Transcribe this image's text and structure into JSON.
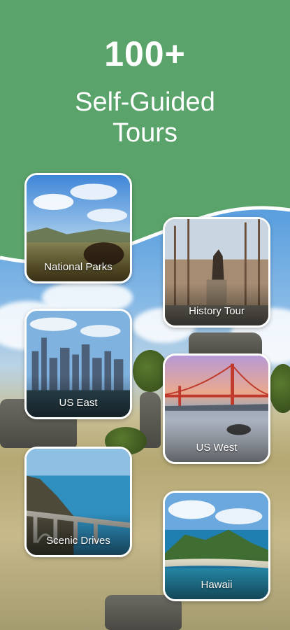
{
  "header": {
    "count": "100+",
    "line1": "Self-Guided",
    "line2": "Tours",
    "color": "#5aa36a"
  },
  "cards": [
    {
      "label": "National Parks",
      "icon": "national-parks-photo"
    },
    {
      "label": "History Tour",
      "icon": "history-tour-photo"
    },
    {
      "label": "US East",
      "icon": "us-east-photo"
    },
    {
      "label": "US West",
      "icon": "us-west-photo"
    },
    {
      "label": "Scenic Drives",
      "icon": "scenic-drives-photo"
    },
    {
      "label": "Hawaii",
      "icon": "hawaii-photo"
    }
  ]
}
